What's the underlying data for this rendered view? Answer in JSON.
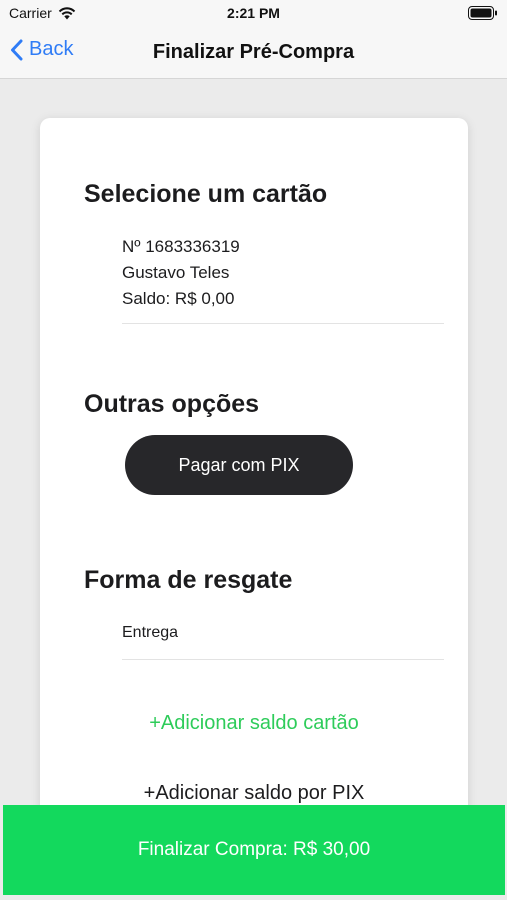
{
  "status_bar": {
    "carrier": "Carrier",
    "time": "2:21 PM"
  },
  "nav": {
    "back_label": "Back",
    "title": "Finalizar Pré-Compra"
  },
  "card_section": {
    "title": "Selecione um cartão",
    "card_number": "Nº 1683336319",
    "holder": "Gustavo Teles",
    "balance": "Saldo: R$ 0,00"
  },
  "other_options": {
    "title": "Outras opções",
    "pix_button": "Pagar com PIX"
  },
  "redeem": {
    "title": "Forma de resgate",
    "method": "Entrega"
  },
  "links": {
    "add_card_balance": "+Adicionar saldo cartão",
    "add_pix_balance": "+Adicionar saldo por PIX"
  },
  "footer": {
    "finalize_label": "Finalizar Compra: R$ 30,00"
  },
  "colors": {
    "accent_blue": "#2f7cf6",
    "accent_green": "#13d95d",
    "link_green": "#2ecc5a",
    "button_dark": "#27272a"
  },
  "icons": {
    "wifi": "wifi-icon",
    "battery": "battery-icon",
    "back": "chevron-left-icon"
  }
}
